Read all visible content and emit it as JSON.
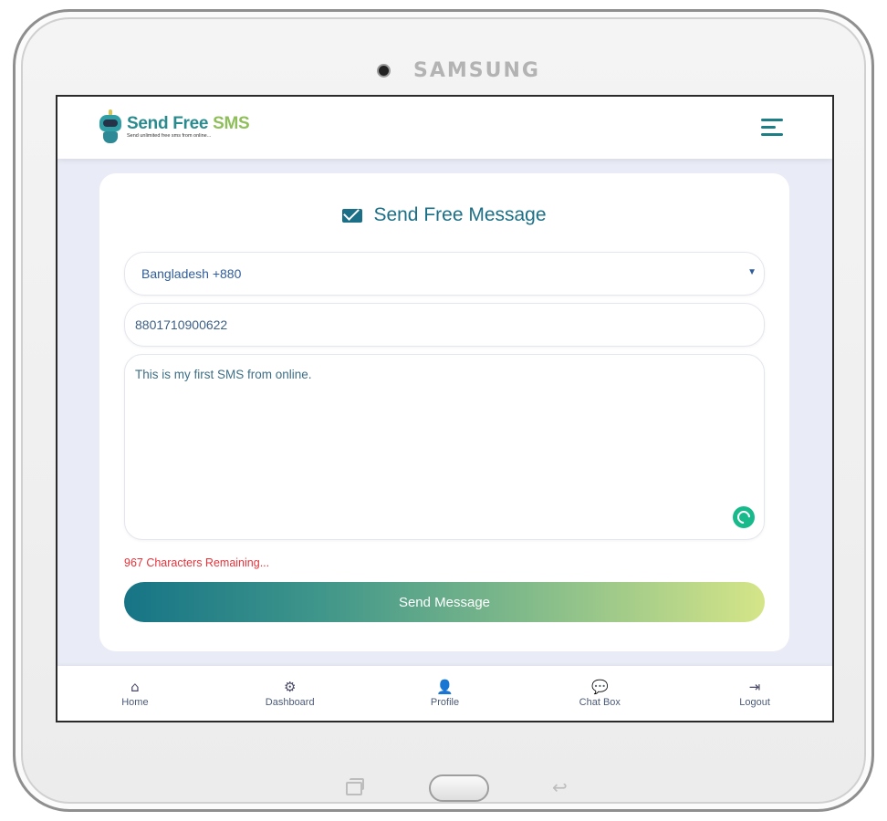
{
  "device": {
    "brand": "SAMSUNG"
  },
  "header": {
    "logo_title_part1": "Send Free ",
    "logo_title_part2": "SMS",
    "logo_tagline": "Send unlimited free sms from online..."
  },
  "card": {
    "title": "Send Free Message",
    "country_select": {
      "selected": "Bangladesh +880"
    },
    "phone_input": {
      "value": "8801710900622"
    },
    "message_input": {
      "value": "This is my first SMS from online."
    },
    "char_remaining": "967 Characters Remaining...",
    "send_button_label": "Send Message"
  },
  "bottom_nav": {
    "items": [
      {
        "label": "Home",
        "icon": "home-icon"
      },
      {
        "label": "Dashboard",
        "icon": "cogs-icon"
      },
      {
        "label": "Profile",
        "icon": "user-icon"
      },
      {
        "label": "Chat Box",
        "icon": "chat-icon"
      },
      {
        "label": "Logout",
        "icon": "logout-icon"
      }
    ]
  },
  "colors": {
    "accent": "#1b6f86",
    "warning": "#e5333a",
    "gradient_start": "#167486",
    "gradient_end": "#d5e588"
  }
}
